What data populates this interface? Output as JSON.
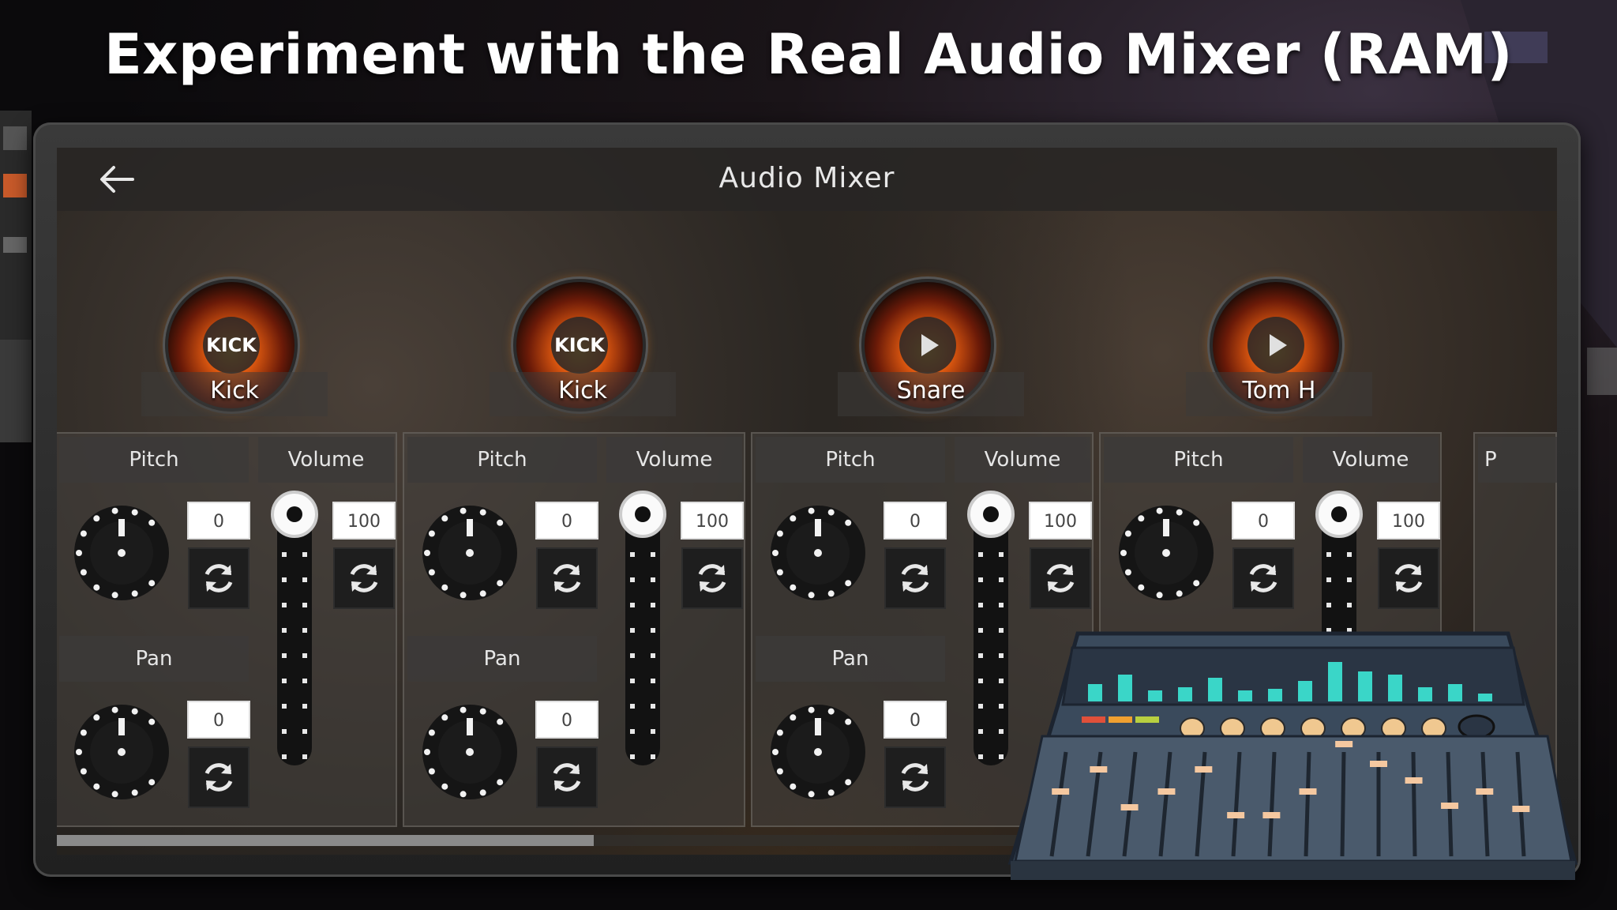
{
  "headline": "Experiment with the Real Audio Mixer (RAM)",
  "screen": {
    "title": "Audio Mixer"
  },
  "labels": {
    "pitch": "Pitch",
    "volume": "Volume",
    "pan": "Pan"
  },
  "channels": [
    {
      "name": "Kick",
      "pad_text": "KICK",
      "pitch": "0",
      "volume": "100",
      "pan": "0",
      "volume_level": 1.0
    },
    {
      "name": "Kick",
      "pad_text": "KICK",
      "pitch": "0",
      "volume": "100",
      "pan": "0",
      "volume_level": 1.0
    },
    {
      "name": "Snare",
      "pad_text": "",
      "pitch": "0",
      "volume": "100",
      "pan": "0",
      "volume_level": 1.0
    },
    {
      "name": "Tom H",
      "pad_text": "",
      "pitch": "0",
      "volume": "100",
      "pan": "",
      "volume_level": 1.0
    }
  ],
  "partial_channel_header": "P",
  "scroll_position": 0.36,
  "colors": {
    "accent_fire": "#e05a10",
    "panel": "#46423e",
    "mixer_cyan": "#3ad6c8"
  },
  "icons": {
    "back": "arrow-left-icon",
    "reset": "refresh-icon",
    "play": "play-icon"
  }
}
